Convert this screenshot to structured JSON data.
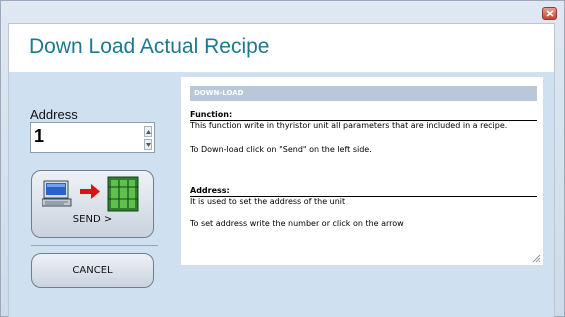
{
  "window": {
    "title": ""
  },
  "page": {
    "title": "Down Load Actual Recipe"
  },
  "address": {
    "label": "Address",
    "value": "1"
  },
  "buttons": {
    "send_label": "SEND >",
    "cancel_label": "CANCEL"
  },
  "help": {
    "header": "DOWN-LOAD",
    "function_heading": "Function:",
    "function_text": "This function write in thyristor unit all parameters that are included in a recipe.",
    "download_text": "To Down-load click on \"Send\" on the left side.",
    "address_heading": "Address:",
    "address_text": "It is used to set the address of the unit",
    "address_hint": "To set address write the number or click on the arrow"
  },
  "icons": [
    "close-icon",
    "computer-icon",
    "arrow-right-icon",
    "thyristor-unit-icon",
    "spin-up-icon",
    "spin-down-icon",
    "resize-grip-icon"
  ],
  "colors": {
    "title": "#1d7a8e",
    "help_header_bg": "#b8c8da",
    "arrow": "#e01010",
    "close": "#c2462f"
  }
}
